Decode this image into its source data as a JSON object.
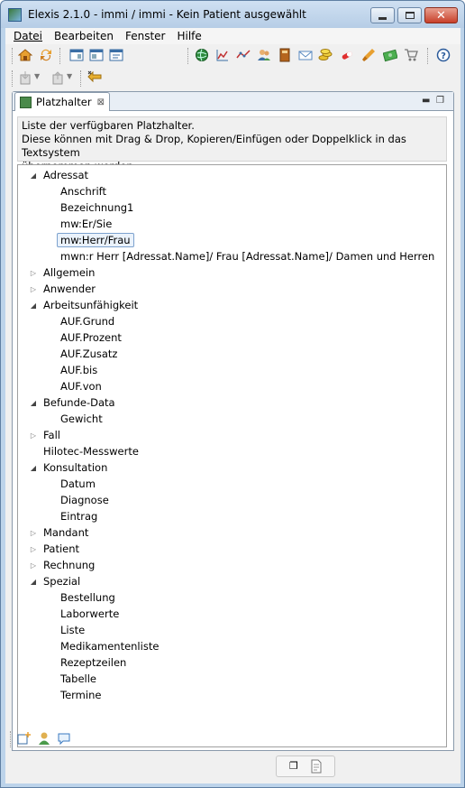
{
  "window": {
    "title": "Elexis 2.1.0 -  immi / immi  -  Kein Patient ausgewählt"
  },
  "menu": [
    {
      "label": "Datei"
    },
    {
      "label": "Bearbeiten"
    },
    {
      "label": "Fenster"
    },
    {
      "label": "Hilfe"
    }
  ],
  "toolbar": {
    "icons": [
      "home-icon",
      "refresh-icon",
      "window-icon",
      "window-list-icon",
      "window-export-icon",
      "globe-icon",
      "chart-icon",
      "graph-icon",
      "contacts-icon",
      "book-icon",
      "mail-icon",
      "coins-icon",
      "pill-icon",
      "brush-icon",
      "money-icon",
      "cart-icon",
      "help-icon",
      "import-icon",
      "export-icon",
      "leave-icon"
    ]
  },
  "view": {
    "tab_label": "Platzhalter",
    "description": [
      "Liste der verfügbaren Platzhalter.",
      "Diese können mit Drag & Drop, Kopieren/Einfügen oder Doppelklick in das Textsystem",
      "übernommen werden."
    ]
  },
  "tree": [
    {
      "label": "Adressat",
      "expanded": true,
      "children": [
        {
          "label": "Anschrift"
        },
        {
          "label": "Bezeichnung1"
        },
        {
          "label": "mw:Er/Sie"
        },
        {
          "label": "mw:Herr/Frau",
          "selected": true
        },
        {
          "label": "mwn:r Herr [Adressat.Name]/ Frau [Adressat.Name]/ Damen und Herren"
        }
      ]
    },
    {
      "label": "Allgemein",
      "expanded": false
    },
    {
      "label": "Anwender",
      "expanded": false
    },
    {
      "label": "Arbeitsunfähigkeit",
      "expanded": true,
      "children": [
        {
          "label": "AUF.Grund"
        },
        {
          "label": "AUF.Prozent"
        },
        {
          "label": "AUF.Zusatz"
        },
        {
          "label": "AUF.bis"
        },
        {
          "label": "AUF.von"
        }
      ]
    },
    {
      "label": "Befunde-Data",
      "expanded": true,
      "children": [
        {
          "label": "Gewicht"
        }
      ]
    },
    {
      "label": "Fall",
      "expanded": false
    },
    {
      "label": "Hilotec-Messwerte",
      "leaf": true
    },
    {
      "label": "Konsultation",
      "expanded": true,
      "children": [
        {
          "label": "Datum"
        },
        {
          "label": "Diagnose"
        },
        {
          "label": "Eintrag"
        }
      ]
    },
    {
      "label": "Mandant",
      "expanded": false
    },
    {
      "label": "Patient",
      "expanded": false
    },
    {
      "label": "Rechnung",
      "expanded": false
    },
    {
      "label": "Spezial",
      "expanded": true,
      "children": [
        {
          "label": "Bestellung"
        },
        {
          "label": "Laborwerte"
        },
        {
          "label": "Liste"
        },
        {
          "label": "Medikamentenliste"
        },
        {
          "label": "Rezeptzeilen"
        },
        {
          "label": "Tabelle"
        },
        {
          "label": "Termine"
        }
      ]
    }
  ]
}
